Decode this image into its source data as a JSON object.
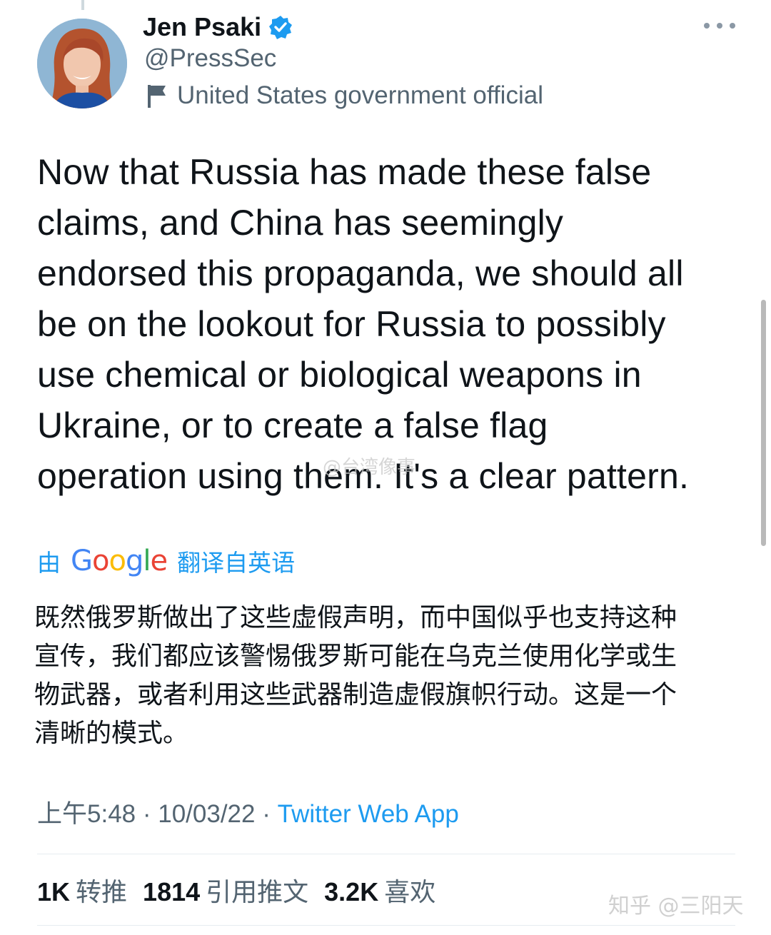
{
  "author": {
    "name": "Jen Psaki",
    "handle": "@PressSec",
    "label": "United States government official",
    "verified_icon": "verified-badge-icon",
    "label_icon": "flag-icon"
  },
  "tweet": {
    "text": "Now that Russia has made these false\nclaims, and China has seemingly\nendorsed this propaganda, we should all\nbe on the lookout for Russia to possibly\nuse chemical or biological weapons in\nUkraine, or to create a false flag\noperation using them. It's a clear pattern."
  },
  "translation": {
    "prefix": "由",
    "provider": "Google",
    "suffix": "翻译自英语",
    "text": "既然俄罗斯做出了这些虚假声明，而中国似乎也支持这种\n宣传，我们都应该警惕俄罗斯可能在乌克兰使用化学或生\n物武器，或者利用这些武器制造虚假旗帜行动。这是一个\n清晰的模式。"
  },
  "meta": {
    "time": "上午5:48",
    "date": "10/03/22",
    "separator": "·",
    "source": "Twitter Web App"
  },
  "stats": [
    {
      "value": "1K",
      "label": "转推"
    },
    {
      "value": "1814",
      "label": "引用推文"
    },
    {
      "value": "3.2K",
      "label": "喜欢"
    }
  ],
  "watermarks": {
    "weibo": "@台湾像事",
    "zhihu": "知乎 @三阳天"
  },
  "colors": {
    "link_blue": "#1d9bf0",
    "secondary_text": "#536471",
    "primary_text": "#0f1419"
  }
}
